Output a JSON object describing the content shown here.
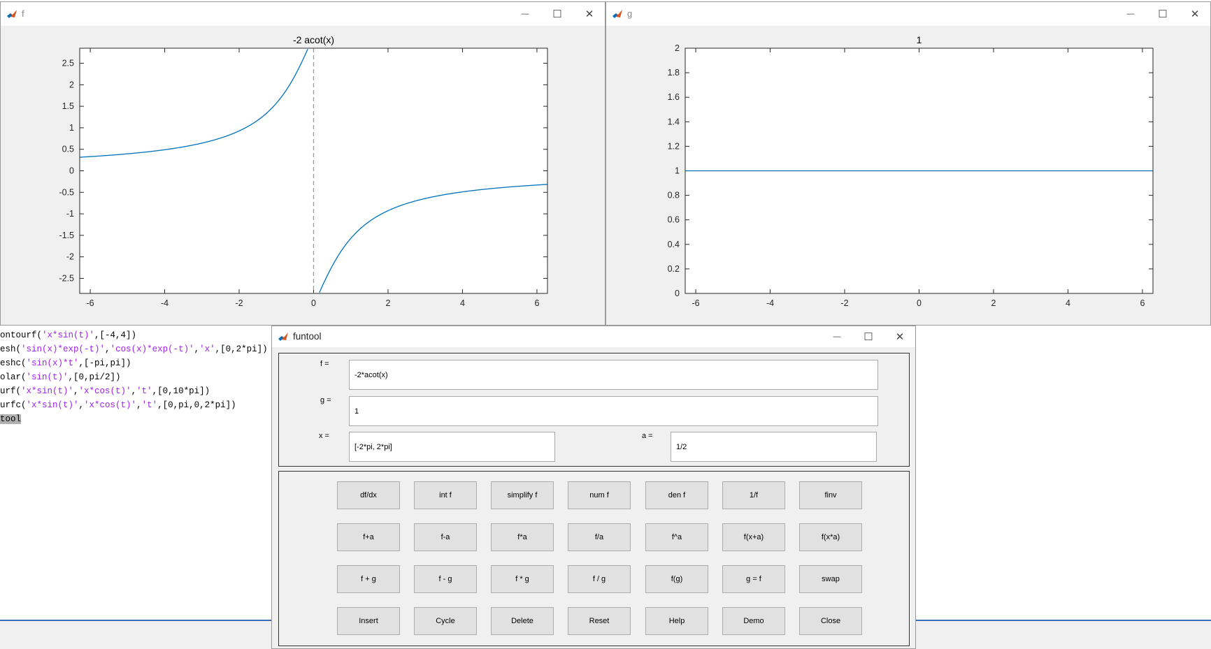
{
  "command_window": {
    "lines": [
      {
        "prefix": "ontourf(",
        "parts": [
          {
            "t": "'x*sin(t)'",
            "s": true
          },
          {
            "t": ",[-4,4])",
            "s": false
          }
        ]
      },
      {
        "prefix": "esh(",
        "parts": [
          {
            "t": "'sin(x)*exp(-t)'",
            "s": true
          },
          {
            "t": ",",
            "s": false
          },
          {
            "t": "'cos(x)*exp(-t)'",
            "s": true
          },
          {
            "t": ",",
            "s": false
          },
          {
            "t": "'x'",
            "s": true
          },
          {
            "t": ",[0,2*pi])",
            "s": false
          }
        ]
      },
      {
        "prefix": "eshc(",
        "parts": [
          {
            "t": "'sin(x)*t'",
            "s": true
          },
          {
            "t": ",[-pi,pi])",
            "s": false
          }
        ]
      },
      {
        "prefix": "olar(",
        "parts": [
          {
            "t": "'sin(t)'",
            "s": true
          },
          {
            "t": ",[0,pi/2])",
            "s": false
          }
        ]
      },
      {
        "prefix": "urf(",
        "parts": [
          {
            "t": "'x*sin(t)'",
            "s": true
          },
          {
            "t": ",",
            "s": false
          },
          {
            "t": "'x*cos(t)'",
            "s": true
          },
          {
            "t": ",",
            "s": false
          },
          {
            "t": "'t'",
            "s": true
          },
          {
            "t": ",[0,10*pi])",
            "s": false
          }
        ]
      },
      {
        "prefix": "urfc(",
        "parts": [
          {
            "t": "'x*sin(t)'",
            "s": true
          },
          {
            "t": ",",
            "s": false
          },
          {
            "t": "'x*cos(t)'",
            "s": true
          },
          {
            "t": ",",
            "s": false
          },
          {
            "t": "'t'",
            "s": true
          },
          {
            "t": ",[0,pi,0,2*pi])",
            "s": false
          }
        ]
      },
      {
        "prefix": "",
        "parts": [
          {
            "t": "tool",
            "s": false,
            "hl": true
          }
        ]
      }
    ]
  },
  "figure_f": {
    "window_title": "f",
    "icon": "matlab-icon",
    "controls": {
      "minimize": "—",
      "maximize": "☐",
      "close": "✕"
    }
  },
  "figure_g": {
    "window_title": "g",
    "icon": "matlab-icon",
    "controls": {
      "minimize": "—",
      "maximize": "☐",
      "close": "✕"
    }
  },
  "chart_data": [
    {
      "type": "line",
      "title": "-2 acot(x)",
      "xlim": [
        -6.283,
        6.283
      ],
      "ylim": [
        -2.85,
        2.85
      ],
      "xticks": [
        -6,
        -4,
        -2,
        0,
        2,
        4,
        6
      ],
      "yticks": [
        2.5,
        2,
        1.5,
        1,
        0.5,
        0,
        -0.5,
        -1,
        -1.5,
        -2,
        -2.5
      ],
      "series": [
        {
          "function": "-2*acot(x)",
          "color": "#0072bd"
        }
      ],
      "asymptote_x": 0,
      "grid": false
    },
    {
      "type": "line",
      "title": "1",
      "xlim": [
        -6.283,
        6.283
      ],
      "ylim": [
        0,
        2
      ],
      "xticks": [
        -6,
        -4,
        -2,
        0,
        2,
        4,
        6
      ],
      "yticks": [
        2,
        1.8,
        1.6,
        1.4,
        1.2,
        1,
        0.8,
        0.6,
        0.4,
        0.2,
        0
      ],
      "series": [
        {
          "function": "1",
          "color": "#0072bd"
        }
      ],
      "grid": false
    }
  ],
  "funtool": {
    "window_title": "funtool",
    "icon": "matlab-icon",
    "controls": {
      "minimize": "—",
      "maximize": "☐",
      "close": "✕"
    },
    "f_label": "f =",
    "f_value": "-2*acot(x)",
    "g_label": "g =",
    "g_value": "1",
    "x_label": "x =",
    "x_value": "[-2*pi, 2*pi]",
    "a_label": "a =",
    "a_value": "1/2",
    "buttons": [
      [
        "df/dx",
        "int f",
        "simplify f",
        "num f",
        "den f",
        "1/f",
        "finv"
      ],
      [
        "f+a",
        "f-a",
        "f*a",
        "f/a",
        "f^a",
        "f(x+a)",
        "f(x*a)"
      ],
      [
        "f + g",
        "f - g",
        "f * g",
        "f / g",
        "f(g)",
        "g = f",
        "swap"
      ],
      [
        "Insert",
        "Cycle",
        "Delete",
        "Reset",
        "Help",
        "Demo",
        "Close"
      ]
    ]
  }
}
